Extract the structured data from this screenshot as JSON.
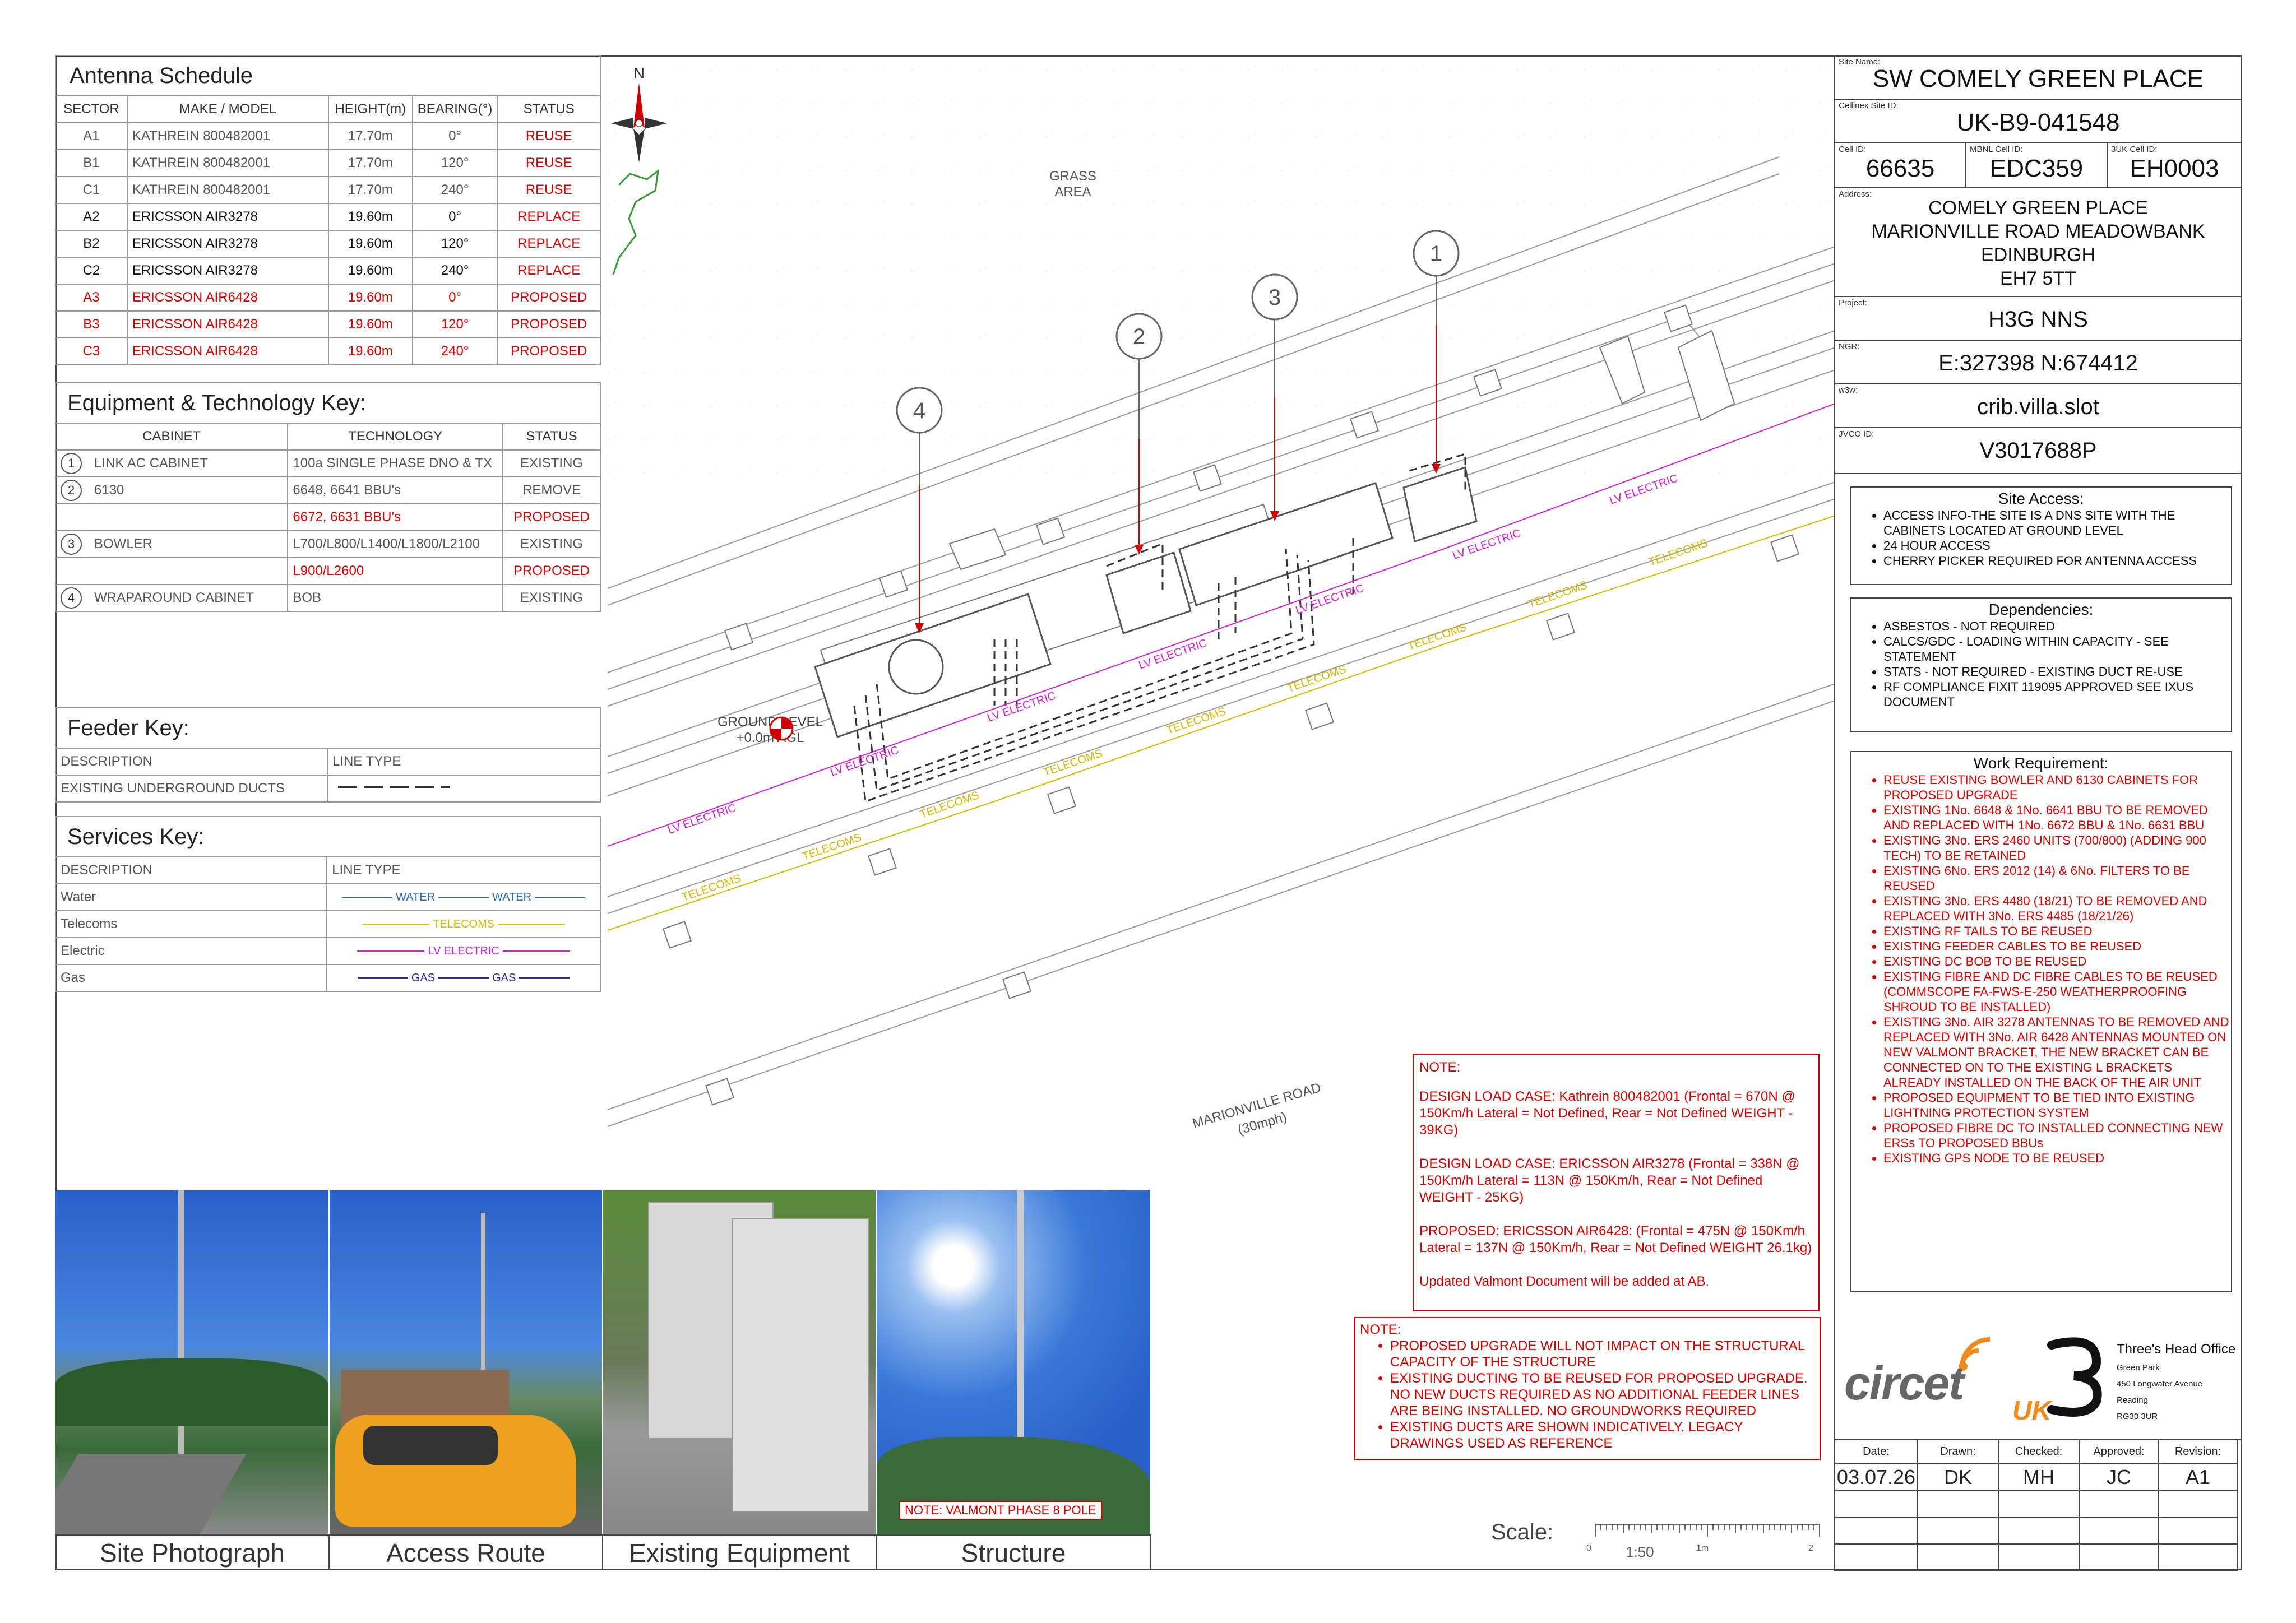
{
  "antenna_schedule": {
    "title": "Antenna Schedule",
    "headers": [
      "SECTOR",
      "MAKE / MODEL",
      "HEIGHT(m)",
      "BEARING(°)",
      "STATUS"
    ],
    "rows": [
      {
        "sector": "A1",
        "model": "KATHREIN 800482001",
        "height": "17.70m",
        "bearing": "0°",
        "status": "REUSE",
        "style": "gray"
      },
      {
        "sector": "B1",
        "model": "KATHREIN 800482001",
        "height": "17.70m",
        "bearing": "120°",
        "status": "REUSE",
        "style": "gray"
      },
      {
        "sector": "C1",
        "model": "KATHREIN 800482001",
        "height": "17.70m",
        "bearing": "240°",
        "status": "REUSE",
        "style": "gray"
      },
      {
        "sector": "A2",
        "model": "ERICSSON AIR3278",
        "height": "19.60m",
        "bearing": "0°",
        "status": "REPLACE",
        "style": "blk"
      },
      {
        "sector": "B2",
        "model": "ERICSSON AIR3278",
        "height": "19.60m",
        "bearing": "120°",
        "status": "REPLACE",
        "style": "blk"
      },
      {
        "sector": "C2",
        "model": "ERICSSON AIR3278",
        "height": "19.60m",
        "bearing": "240°",
        "status": "REPLACE",
        "style": "blk"
      },
      {
        "sector": "A3",
        "model": "ERICSSON AIR6428",
        "height": "19.60m",
        "bearing": "0°",
        "status": "PROPOSED",
        "style": "red"
      },
      {
        "sector": "B3",
        "model": "ERICSSON AIR6428",
        "height": "19.60m",
        "bearing": "120°",
        "status": "PROPOSED",
        "style": "red"
      },
      {
        "sector": "C3",
        "model": "ERICSSON AIR6428",
        "height": "19.60m",
        "bearing": "240°",
        "status": "PROPOSED",
        "style": "red"
      }
    ]
  },
  "equipment_key": {
    "title": "Equipment & Technology Key:",
    "headers": [
      "CABINET",
      "TECHNOLOGY",
      "STATUS"
    ],
    "rows": [
      {
        "num": "1",
        "cabinet": "LINK AC CABINET",
        "tech": "100a SINGLE PHASE DNO & TX",
        "status": "EXISTING",
        "red": false
      },
      {
        "num": "2",
        "cabinet": "6130",
        "tech": "6648, 6641 BBU's",
        "status": "REMOVE",
        "red": false
      },
      {
        "num": "",
        "cabinet": "",
        "tech": "6672, 6631 BBU's",
        "status": "PROPOSED",
        "red": true
      },
      {
        "num": "3",
        "cabinet": "BOWLER",
        "tech": "L700/L800/L1400/L1800/L2100",
        "status": "EXISTING",
        "red": false
      },
      {
        "num": "",
        "cabinet": "",
        "tech": "L900/L2600",
        "status": "PROPOSED",
        "red": true
      },
      {
        "num": "4",
        "cabinet": "WRAPAROUND CABINET",
        "tech": "BOB",
        "status": "EXISTING",
        "red": false
      }
    ]
  },
  "feeder_key": {
    "title": "Feeder Key:",
    "headers": [
      "DESCRIPTION",
      "LINE TYPE"
    ],
    "rows": [
      {
        "desc": "EXISTING UNDERGROUND DUCTS"
      }
    ]
  },
  "services_key": {
    "title": "Services Key:",
    "headers": [
      "DESCRIPTION",
      "LINE TYPE"
    ],
    "rows": [
      {
        "desc": "Water",
        "label": "WATER",
        "color": "#2a6db0"
      },
      {
        "desc": "Telecoms",
        "label": "TELECOMS",
        "color": "#d4b800"
      },
      {
        "desc": "Electric",
        "label": "LV ELECTRIC",
        "color": "#d020d0"
      },
      {
        "desc": "Gas",
        "label": "GAS",
        "color": "#2a2aa0"
      }
    ]
  },
  "plan": {
    "north": "N",
    "grass": "GRASS\nAREA",
    "ground_level_1": "GROUND LEVEL",
    "ground_level_2": "+0.0m AGL",
    "road_1": "MARIONVILLE ROAD",
    "road_2": "(30mph)",
    "markers": [
      "1",
      "2",
      "3",
      "4"
    ],
    "lv_label": "LV ELECTRIC",
    "tel_label": "TELECOMS"
  },
  "notes_design": {
    "heading": "NOTE:",
    "paragraphs": [
      "DESIGN LOAD CASE: Kathrein 800482001 (Frontal = 670N @ 150Km/h Lateral = Not Defined, Rear =  Not Defined WEIGHT -  39KG)",
      "DESIGN LOAD CASE: ERICSSON AIR3278 (Frontal = 338N @ 150Km/h Lateral = 113N @ 150Km/h, Rear =  Not Defined WEIGHT -  25KG)",
      "PROPOSED: ERICSSON AIR6428: (Frontal = 475N @ 150Km/h Lateral = 137N @ 150Km/h, Rear =  Not Defined WEIGHT 26.1kg)",
      "Updated Valmont Document will be added at AB."
    ]
  },
  "notes_general": {
    "heading": "NOTE:",
    "items": [
      "PROPOSED UPGRADE WILL NOT IMPACT ON THE STRUCTURAL CAPACITY OF THE STRUCTURE",
      "EXISTING DUCTING TO BE REUSED FOR PROPOSED UPGRADE. NO NEW DUCTS REQUIRED AS NO ADDITIONAL FEEDER LINES ARE BEING INSTALLED. NO GROUNDWORKS REQUIRED",
      "EXISTING DUCTS ARE SHOWN INDICATIVELY. LEGACY DRAWINGS USED AS REFERENCE"
    ]
  },
  "photos": {
    "captions": [
      "Site Photograph",
      "Access Route",
      "Existing Equipment",
      "Structure"
    ],
    "structure_note": "NOTE: VALMONT PHASE 8 POLE"
  },
  "scale": {
    "label": "Scale:",
    "ratio": "1:50",
    "t0": "0",
    "t1": "1m",
    "t2": "2"
  },
  "title_block": {
    "site_name_label": "Site Name:",
    "site_name": "SW COMELY GREEN PLACE",
    "cellinex_label": "Cellinex Site ID:",
    "cellinex": "UK-B9-041548",
    "cell_id_label": "Cell ID:",
    "cell_id": "66635",
    "mbnl_label": "MBNL Cell ID:",
    "mbnl": "EDC359",
    "threeuk_label": "3UK Cell ID:",
    "threeuk": "EH0003",
    "address_label": "Address:",
    "address": [
      "COMELY GREEN PLACE",
      "MARIONVILLE ROAD MEADOWBANK",
      "EDINBURGH",
      "EH7 5TT"
    ],
    "project_label": "Project:",
    "project": "H3G NNS",
    "ngr_label": "NGR:",
    "ngr": "E:327398 N:674412",
    "w3w_label": "w3w:",
    "w3w": "crib.villa.slot",
    "jvco_label": "JVCO ID:",
    "jvco": "V3017688P"
  },
  "site_access": {
    "title": "Site Access:",
    "items": [
      "ACCESS INFO-THE SITE IS A DNS SITE WITH THE CABINETS LOCATED AT GROUND LEVEL",
      "24 HOUR ACCESS",
      "CHERRY PICKER REQUIRED FOR ANTENNA ACCESS"
    ]
  },
  "dependencies": {
    "title": "Dependencies:",
    "items": [
      "ASBESTOS - NOT REQUIRED",
      "CALCS/GDC - LOADING WITHIN CAPACITY - SEE STATEMENT",
      "STATS - NOT REQUIRED - EXISTING DUCT RE-USE",
      "RF COMPLIANCE FIXIT 119095 APPROVED SEE IXUS DOCUMENT"
    ]
  },
  "work_requirement": {
    "title": "Work Requirement:",
    "items": [
      "REUSE EXISTING BOWLER AND 6130 CABINETS FOR PROPOSED UPGRADE",
      "EXISTING 1No. 6648 & 1No. 6641 BBU TO BE REMOVED AND REPLACED WITH 1No. 6672 BBU & 1No. 6631 BBU",
      "EXISTING 3No. ERS 2460 UNITS (700/800) (ADDING 900 TECH) TO BE RETAINED",
      "EXISTING 6No. ERS 2012 (14) & 6No. FILTERS TO BE REUSED",
      "EXISTING 3No. ERS 4480 (18/21) TO BE REMOVED AND REPLACED WITH 3No. ERS 4485 (18/21/26)",
      "EXISTING RF TAILS TO BE REUSED",
      "EXISTING FEEDER CABLES TO BE REUSED",
      "EXISTING DC BOB TO BE REUSED",
      "EXISTING FIBRE AND DC FIBRE CABLES TO BE REUSED (COMMSCOPE FA-FWS-E-250 WEATHERPROOFING SHROUD TO BE INSTALLED)",
      "EXISTING 3No. AIR 3278 ANTENNAS TO BE REMOVED AND REPLACED WITH 3No. AIR 6428 ANTENNAS MOUNTED ON NEW VALMONT BRACKET, THE NEW BRACKET CAN BE CONNECTED ON TO THE EXISTING L BRACKETS ALREADY INSTALLED ON THE BACK OF THE AIR UNIT",
      "PROPOSED EQUIPMENT TO BE TIED INTO EXISTING LIGHTNING PROTECTION SYSTEM",
      "PROPOSED FIBRE DC TO INSTALLED CONNECTING NEW ERSs TO PROPOSED BBUs",
      "EXISTING GPS NODE TO BE REUSED"
    ]
  },
  "logos": {
    "circet": "circet",
    "circet_uk": "UK",
    "three_office_title": "Three's Head Office",
    "three_office": [
      "Green Park",
      "450 Longwater Avenue",
      "Reading",
      "RG30 3UR"
    ]
  },
  "revision": {
    "headers": [
      "Date:",
      "Drawn:",
      "Checked:",
      "Approved:",
      "Revision:"
    ],
    "values": [
      "03.07.26",
      "DK",
      "MH",
      "JC",
      "A1"
    ]
  },
  "colors": {
    "red": "#d00000",
    "lv": "#d020d0",
    "telecoms": "#d4b800",
    "water": "#2a6db0",
    "gas": "#2a2aa0"
  }
}
